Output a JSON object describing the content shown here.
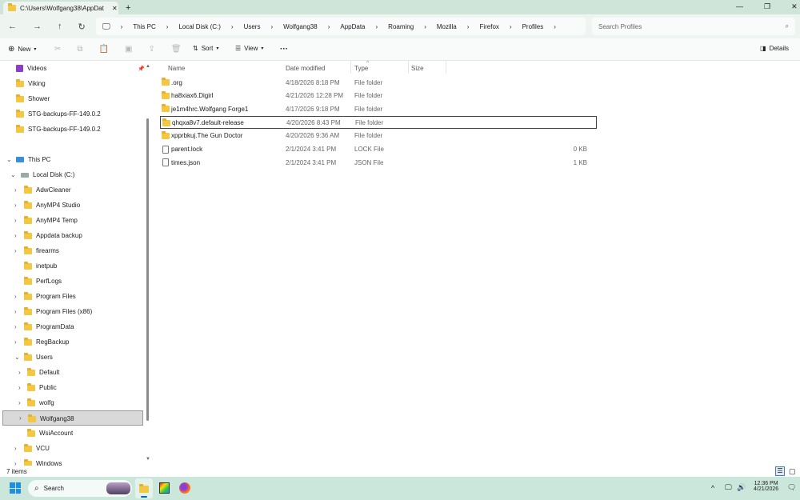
{
  "window": {
    "tab_title": "C:\\Users\\Wolfgang38\\AppDat",
    "new_tab": "+",
    "controls": [
      "—",
      "❐",
      "✕"
    ]
  },
  "breadcrumb": [
    "This PC",
    "Local Disk (C:)",
    "Users",
    "Wolfgang38",
    "AppData",
    "Roaming",
    "Mozilla",
    "Firefox",
    "Profiles"
  ],
  "search": {
    "placeholder": "Search Profiles"
  },
  "toolbar": {
    "new": "New",
    "sort": "Sort",
    "view": "View",
    "more": "···",
    "details": "Details"
  },
  "sidebar": {
    "pinned": [
      "Videos",
      "Viking",
      "Shower",
      "STG-backups-FF-149.0.2",
      "STG-backups-FF-149.0.2"
    ],
    "this_pc": "This PC",
    "local_disk": "Local Disk (C:)",
    "disk_items": [
      "AdwCleaner",
      "AnyMP4 Studio",
      "AnyMP4 Temp",
      "Appdata backup",
      "firearms",
      "inetpub",
      "PerfLogs",
      "Program Files",
      "Program Files (x86)",
      "ProgramData",
      "RegBackup",
      "Users"
    ],
    "user_items": [
      "Default",
      "Public",
      "wolfg",
      "Wolfgang38"
    ],
    "after_items": [
      "WsiAccount",
      "VCU",
      "Windows"
    ],
    "selected": "Wolfgang38"
  },
  "columns": {
    "name": "Name",
    "date": "Date modified",
    "type": "Type",
    "size": "Size"
  },
  "files": [
    {
      "name": ".org",
      "date": "4/18/2026 8:18 PM",
      "type": "File folder",
      "size": "",
      "kind": "folder"
    },
    {
      "name": "ha8xiax6.Digirl",
      "date": "4/21/2026 12:28 PM",
      "type": "File folder",
      "size": "",
      "kind": "folder"
    },
    {
      "name": "je1m4hrc.Wolfgang Forge1",
      "date": "4/17/2026 9:18 PM",
      "type": "File folder",
      "size": "",
      "kind": "folder"
    },
    {
      "name": "qhqxa8v7.default-release",
      "date": "4/20/2026 8:43 PM",
      "type": "File folder",
      "size": "",
      "kind": "folder",
      "focused": true
    },
    {
      "name": "xpprbkuj.The Gun Doctor",
      "date": "4/20/2026 9:36 AM",
      "type": "File folder",
      "size": "",
      "kind": "folder"
    },
    {
      "name": "parent.lock",
      "date": "2/1/2024 3:41 PM",
      "type": "LOCK File",
      "size": "0 KB",
      "kind": "file"
    },
    {
      "name": "times.json",
      "date": "2/1/2024 3:41 PM",
      "type": "JSON File",
      "size": "1 KB",
      "kind": "file"
    }
  ],
  "status": {
    "count": "7 items"
  },
  "taskbar": {
    "search": "Search",
    "time": "12:36 PM",
    "date": "4/21/2026"
  }
}
